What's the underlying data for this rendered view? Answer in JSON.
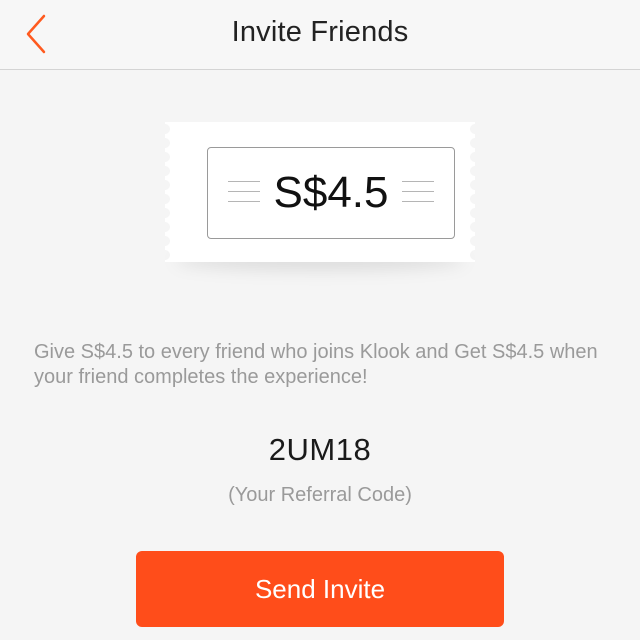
{
  "header": {
    "title": "Invite Friends",
    "back_icon": "chevron-left-icon",
    "accent_color": "#ff5a1f"
  },
  "ticket": {
    "amount": "S$4.5"
  },
  "description": "Give S$4.5 to every friend who joins Klook and Get S$4.5 when your friend completes the experience!",
  "referral": {
    "code": "2UM18",
    "label": "(Your Referral Code)"
  },
  "send_button": {
    "label": "Send Invite",
    "color": "#ff4d1a"
  }
}
